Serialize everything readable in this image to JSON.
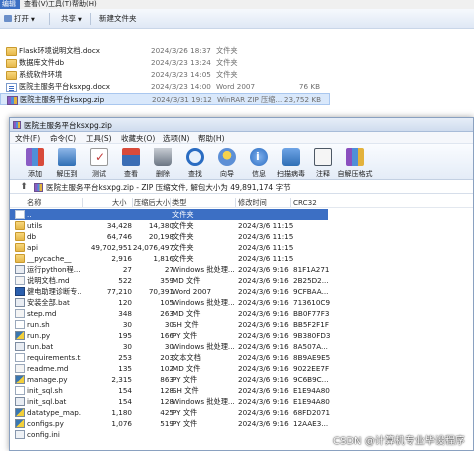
{
  "explorer": {
    "menu": [
      "编辑(E)",
      "查看(V)",
      "工具(T)",
      "帮助(H)"
    ],
    "commands": {
      "open": "打开",
      "share": "共享",
      "new_folder": "新建文件夹"
    },
    "files": [
      {
        "name": "Flask环境说明文档.docx",
        "date": "2024/3/26 18:37",
        "type": "文件夹",
        "size": "",
        "icon": "folder-icon"
      },
      {
        "name": "数据库文件db",
        "date": "2024/3/23 13:24",
        "type": "文件夹",
        "size": "",
        "icon": "folder-icon"
      },
      {
        "name": "系统软件环境",
        "date": "2024/3/23 14:05",
        "type": "文件夹",
        "size": "",
        "icon": "folder-icon"
      },
      {
        "name": "医院主服务平台ksxpg.docx",
        "date": "2024/3/23 14:00",
        "type": "Word 2007",
        "size": "76 KB",
        "icon": "word-doc-icon"
      },
      {
        "name": "医院主服务平台ksxpg.zip",
        "date": "2024/3/31 19:12",
        "type": "WinRAR ZIP 压缩...",
        "size": "23,752 KB",
        "icon": "zip-archive-icon"
      }
    ]
  },
  "winrar": {
    "title": "医院主服务平台ksxpg.zip",
    "menu": [
      "文件(F)",
      "命令(C)",
      "工具(S)",
      "收藏夹(O)",
      "选项(N)",
      "帮助(H)"
    ],
    "toolbar": [
      {
        "label": "添加",
        "icon": "add-icon",
        "color": "#c0392b"
      },
      {
        "label": "解压到",
        "icon": "extract-to-icon",
        "color": "#2f6fb5"
      },
      {
        "label": "测试",
        "icon": "test-icon",
        "color": "#c23b3b"
      },
      {
        "label": "查看",
        "icon": "view-icon",
        "color": "#2f6fb5"
      },
      {
        "label": "删除",
        "icon": "delete-icon",
        "color": "#6b7684"
      },
      {
        "label": "查找",
        "icon": "find-icon",
        "color": "#2a6cc2"
      },
      {
        "label": "向导",
        "icon": "wizard-icon",
        "color": "#5c8fd6"
      },
      {
        "label": "信息",
        "icon": "info-icon",
        "color": "#2a6cc2"
      },
      {
        "label": "扫描病毒",
        "icon": "virus-scan-icon",
        "color": "#2f6fb5"
      },
      {
        "label": "注释",
        "icon": "comment-icon",
        "color": "#4d5865"
      },
      {
        "label": "自解压格式",
        "icon": "sfx-icon",
        "color": "#8a4fbf"
      }
    ],
    "path": "医院主服务平台ksxpg.zip - ZIP 压缩文件, 解包大小为 49,891,174 字节",
    "columns": [
      "名称",
      "大小",
      "压缩后大小",
      "类型",
      "修改时间",
      "CRC32"
    ],
    "rows": [
      {
        "name": "..",
        "size": "",
        "packed": "",
        "type": "文件夹",
        "modified": "",
        "crc": "",
        "icon": "up-folder-icon",
        "selected": true
      },
      {
        "name": "utils",
        "size": "34,428",
        "packed": "14,380",
        "type": "文件夹",
        "modified": "2024/3/6 11:15",
        "crc": "",
        "icon": "folder-icon"
      },
      {
        "name": "db",
        "size": "64,746",
        "packed": "20,198",
        "type": "文件夹",
        "modified": "2024/3/6 11:15",
        "crc": "",
        "icon": "folder-icon"
      },
      {
        "name": "api",
        "size": "49,702,951",
        "packed": "24,076,497",
        "type": "文件夹",
        "modified": "2024/3/6 11:15",
        "crc": "",
        "icon": "folder-icon"
      },
      {
        "name": "__pycache__",
        "size": "2,916",
        "packed": "1,816",
        "type": "文件夹",
        "modified": "2024/3/6 11:15",
        "crc": "",
        "icon": "folder-icon"
      },
      {
        "name": "运行python程...",
        "size": "27",
        "packed": "27",
        "type": "Windows 批处理...",
        "modified": "2024/3/6 9:16",
        "crc": "81F1A271",
        "icon": "batch-file-icon"
      },
      {
        "name": "说明文档.md",
        "size": "522",
        "packed": "359",
        "type": "MD 文件",
        "modified": "2024/3/6 9:16",
        "crc": "2B25D2...",
        "icon": "md-file-icon"
      },
      {
        "name": "健电助理诊断专...",
        "size": "77,210",
        "packed": "70,391",
        "type": "Word 2007",
        "modified": "2024/3/6 9:16",
        "crc": "9CFBAA...",
        "icon": "word-doc-icon"
      },
      {
        "name": "安装全部.bat",
        "size": "120",
        "packed": "105",
        "type": "Windows 批处理...",
        "modified": "2024/3/6 9:16",
        "crc": "713610C9",
        "icon": "batch-file-icon"
      },
      {
        "name": "step.md",
        "size": "348",
        "packed": "263",
        "type": "MD 文件",
        "modified": "2024/3/6 9:16",
        "crc": "BB0F77F3",
        "icon": "md-file-icon"
      },
      {
        "name": "run.sh",
        "size": "30",
        "packed": "30",
        "type": "SH 文件",
        "modified": "2024/3/6 9:16",
        "crc": "BB5F2F1F",
        "icon": "file-icon"
      },
      {
        "name": "run.py",
        "size": "195",
        "packed": "166",
        "type": "PY 文件",
        "modified": "2024/3/6 9:16",
        "crc": "9B380FD3",
        "icon": "python-file-icon"
      },
      {
        "name": "run.bat",
        "size": "30",
        "packed": "30",
        "type": "Windows 批处理...",
        "modified": "2024/3/6 9:16",
        "crc": "8A507A...",
        "icon": "batch-file-icon"
      },
      {
        "name": "requirements.txt",
        "size": "253",
        "packed": "203",
        "type": "文本文档",
        "modified": "2024/3/6 9:16",
        "crc": "8B9AE9E5",
        "icon": "text-file-icon"
      },
      {
        "name": "readme.md",
        "size": "135",
        "packed": "102",
        "type": "MD 文件",
        "modified": "2024/3/6 9:16",
        "crc": "9022EE7F",
        "icon": "md-file-icon"
      },
      {
        "name": "manage.py",
        "size": "2,315",
        "packed": "863",
        "type": "PY 文件",
        "modified": "2024/3/6 9:16",
        "crc": "9C6B9C...",
        "icon": "python-file-icon"
      },
      {
        "name": "init_sql.sh",
        "size": "154",
        "packed": "128",
        "type": "SH 文件",
        "modified": "2024/3/6 9:16",
        "crc": "E1E94A80",
        "icon": "file-icon"
      },
      {
        "name": "init_sql.bat",
        "size": "154",
        "packed": "128",
        "type": "Windows 批处理...",
        "modified": "2024/3/6 9:16",
        "crc": "E1E94A80",
        "icon": "batch-file-icon"
      },
      {
        "name": "datatype_map...",
        "size": "1,180",
        "packed": "425",
        "type": "PY 文件",
        "modified": "2024/3/6 9:16",
        "crc": "68FD2071",
        "icon": "python-file-icon"
      },
      {
        "name": "configs.py",
        "size": "1,076",
        "packed": "519",
        "type": "PY 文件",
        "modified": "2024/3/6 9:16",
        "crc": "12AAE3...",
        "icon": "python-file-icon"
      },
      {
        "name": "config.ini",
        "size": "",
        "packed": "",
        "type": "",
        "modified": "",
        "crc": "",
        "icon": "config-file-icon"
      }
    ]
  },
  "watermark": "CSDN @计算机专业毕设程序",
  "colors": {
    "selection": "#3c6fc4",
    "explorer_selection": "#d9e8fb"
  }
}
